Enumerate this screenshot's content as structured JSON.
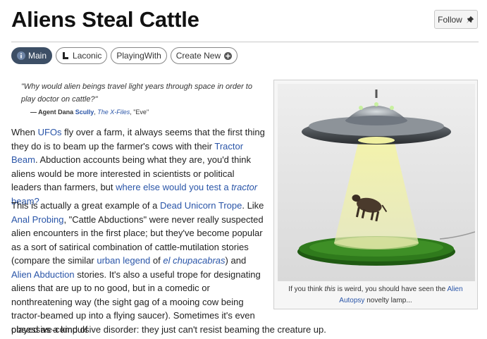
{
  "page": {
    "title": "Aliens Steal Cattle",
    "follow_label": "Follow"
  },
  "tabs": [
    {
      "label": "Main",
      "icon": "info-icon",
      "active": true
    },
    {
      "label": "Laconic",
      "icon": "laconic-icon"
    },
    {
      "label": "PlayingWith"
    },
    {
      "label": "Create New",
      "icon": "plus-circle-icon"
    }
  ],
  "quote": {
    "text": "\"Why would alien beings travel light years through space in order to play doctor on cattle?\"",
    "dash": "— Agent Dana ",
    "name_link": "Scully",
    "sep": ", ",
    "source_link": "The X-Files",
    "episode": ", \"Eve\""
  },
  "para1": {
    "t1": "When ",
    "l1": "UFOs",
    "t2": " fly over a farm, it always seems that the first thing they do is to beam up the farmer's cows with their ",
    "l2": "Tractor Beam",
    "t3": ". Abduction accounts being what they are, you'd think aliens would be more interested in scientists or political leaders than farmers, but ",
    "l3a": "where else would you test a ",
    "l3b": "tractor",
    "l3c": " beam?"
  },
  "para2": {
    "t1": "This is actually a great example of a ",
    "l1": "Dead Unicorn Trope",
    "t2": ". Like ",
    "l2": "Anal Probing",
    "t3": ", \"Cattle Abductions\" were never really suspected alien encounters in the first place; but they've become popular as a sort of satirical combination of cattle-mutilation stories (compare the similar ",
    "l3": "urban legend",
    "t4": " of ",
    "l4a": "el ",
    "l4b": "chupacabras",
    "t5": ") and ",
    "l5": "Alien Abduction",
    "t6": " stories. It's also a useful trope for designating aliens that are up to no good, but in a comedic or nonthreatening way (the sight gag of a mooing cow being tractor-beamed up into a flying saucer). Sometimes it's even played as a kind of",
    "tail": "obsessive-compulsive disorder: they just can't resist beaming the creature up."
  },
  "figure": {
    "caption_t1": "If you think ",
    "caption_em": "this",
    "caption_t2": " is weird, you should have seen the ",
    "caption_link": "Alien Autopsy",
    "caption_t3": " novelty lamp..."
  },
  "colors": {
    "link": "#2a55a8",
    "active_tab": "#3d4f66"
  }
}
